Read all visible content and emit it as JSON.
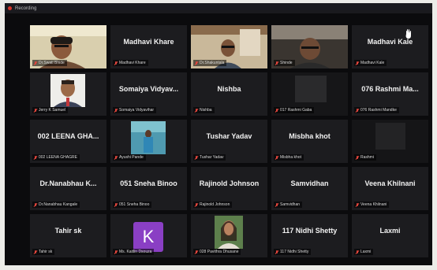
{
  "app": {
    "recording_label": "Recording"
  },
  "colors": {
    "mic_muted": "#e0453c",
    "speaker_outline": "#d6c54a",
    "avatar_bg": "#8a3fc4"
  },
  "tiles": [
    {
      "name": "",
      "label": "Dr.Swati Bhide",
      "video": "video-person-1",
      "speaking": true
    },
    {
      "name": "Madhavi Khare",
      "label": "Madhavi Khare"
    },
    {
      "name": "",
      "label": "Dr.Shakuntala",
      "video": "video-person-2"
    },
    {
      "name": "",
      "label": "Shinde",
      "video": "video-person-3"
    },
    {
      "name": "Madhavi Kale",
      "label": "Madhavi Kale",
      "icon": "raised-hand-icon"
    },
    {
      "name": "",
      "label": "Jerry K Samuel",
      "video": "video-person-4"
    },
    {
      "name": "Somaiya Vidyav...",
      "label": "Somaiya Vidyavihar"
    },
    {
      "name": "Nishba",
      "label": "Nishba"
    },
    {
      "name": "",
      "label": "017 Rashmi Gaba",
      "video": "video-person-5"
    },
    {
      "name": "076 Rashmi Ma...",
      "label": "076 Rashmi Mandke"
    },
    {
      "name": "002 LEENA GHA...",
      "label": "002 LEENA GHAGRE"
    },
    {
      "name": "",
      "label": "Ayushi Pande",
      "video": "video-person-6"
    },
    {
      "name": "Tushar Yadav",
      "label": "Tushar Yadav"
    },
    {
      "name": "Misbha khot",
      "label": "Misbha khot"
    },
    {
      "name": "",
      "label": "Rashmi",
      "video": "video-person-7"
    },
    {
      "name": "Dr.Nanabhau K...",
      "label": "Dr.Nanabhau Kangale"
    },
    {
      "name": "051 Sneha Binoo",
      "label": "051 Sneha Binoo"
    },
    {
      "name": "Rajinold Johnson",
      "label": "Rajinold Johnson"
    },
    {
      "name": "Samvidhan",
      "label": "Samvidhan"
    },
    {
      "name": "Veena Khilnani",
      "label": "Veena Khilnani"
    },
    {
      "name": "Tahir sk",
      "label": "Tahir sk"
    },
    {
      "name": "",
      "label": "Ms. Kaitlin Dsouza",
      "avatar": "K"
    },
    {
      "name": "",
      "label": "028 Pavithra Dhusane",
      "video": "video-person-8"
    },
    {
      "name": "117 Nidhi Shetty",
      "label": "117 Nidhi Shetty"
    },
    {
      "name": "Laxmi",
      "label": "Laxmi"
    }
  ]
}
